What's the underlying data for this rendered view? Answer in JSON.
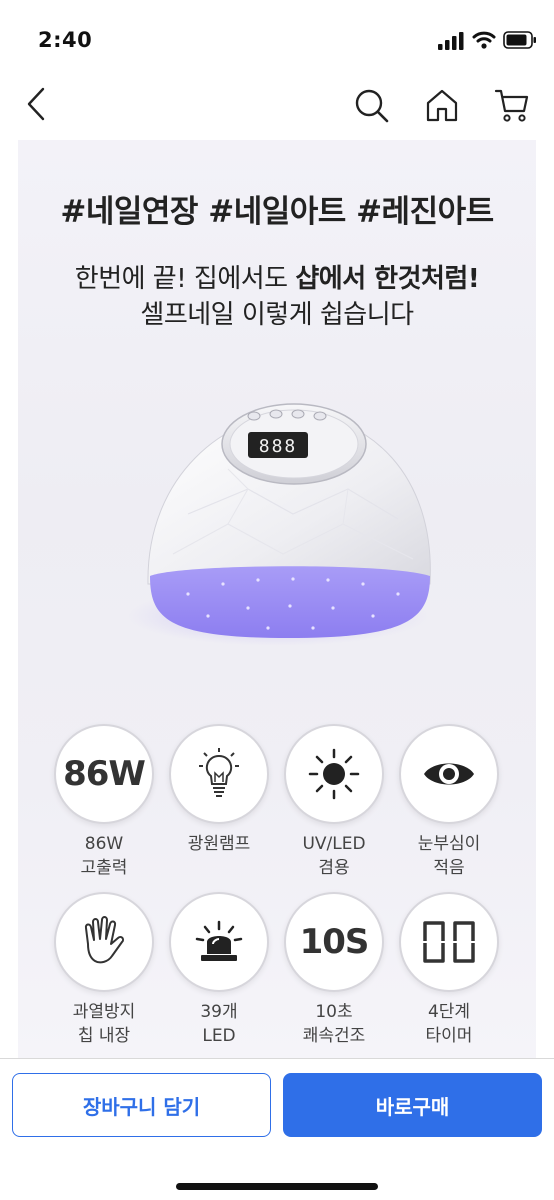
{
  "status_bar": {
    "time": "2:40"
  },
  "nav": {
    "icons": [
      "back-chevron-icon",
      "search-icon",
      "home-icon",
      "cart-icon"
    ]
  },
  "banner": {
    "hashtags": "#네일연장 #네일아트 #레진아트",
    "headline_plain": "한번에 끝! 집에서도 ",
    "headline_bold": "샵에서 한것처럼!",
    "subline": "셀프네일 이렇게 쉽습니다",
    "lamp_display": "888",
    "features": [
      {
        "icon": "text",
        "icon_text": "86W",
        "label_1": "86W",
        "label_2": "고출력"
      },
      {
        "icon": "bulb-icon",
        "icon_text": "",
        "label_1": "광원램프",
        "label_2": ""
      },
      {
        "icon": "sun-icon",
        "icon_text": "",
        "label_1": "UV/LED",
        "label_2": "겸용"
      },
      {
        "icon": "eye-icon",
        "icon_text": "",
        "label_1": "눈부심이",
        "label_2": "적음"
      },
      {
        "icon": "hand-icon",
        "icon_text": "",
        "label_1": "과열방지",
        "label_2": "칩 내장"
      },
      {
        "icon": "siren-icon",
        "icon_text": "",
        "label_1": "39개",
        "label_2": "LED"
      },
      {
        "icon": "text",
        "icon_text": "10S",
        "label_1": "10초",
        "label_2": "쾌속건조"
      },
      {
        "icon": "timer-display-icon",
        "icon_text": "",
        "label_1": "4단계",
        "label_2": "타이머"
      }
    ]
  },
  "actions": {
    "cart_label": "장바구니 담기",
    "buy_label": "바로구매"
  },
  "colors": {
    "accent": "#2f6fe8",
    "uv_glow": "#9b8cf5"
  }
}
